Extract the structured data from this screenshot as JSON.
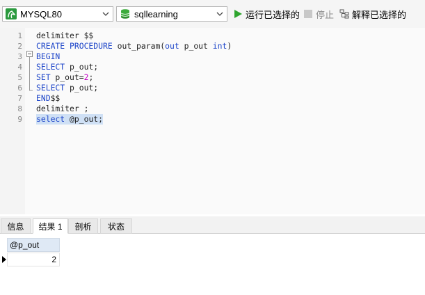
{
  "toolbar": {
    "connection": {
      "value": "MYSQL80",
      "icon": "mysql-dolphin-icon"
    },
    "database": {
      "value": "sqllearning",
      "icon": "database-icon"
    },
    "run_selected_label": "运行已选择的",
    "stop_label": "停止",
    "explain_selected_label": "解释已选择的"
  },
  "editor": {
    "lines": [
      {
        "num": "1",
        "tokens": [
          {
            "t": "delimiter $$",
            "c": ""
          }
        ]
      },
      {
        "num": "2",
        "tokens": [
          {
            "t": "CREATE PROCEDURE",
            "c": "kw"
          },
          {
            "t": " out_param(",
            "c": ""
          },
          {
            "t": "out",
            "c": "kw"
          },
          {
            "t": " p_out ",
            "c": ""
          },
          {
            "t": "int",
            "c": "kw"
          },
          {
            "t": ")",
            "c": ""
          }
        ]
      },
      {
        "num": "3",
        "tokens": [
          {
            "t": "BEGIN",
            "c": "kw"
          }
        ]
      },
      {
        "num": "4",
        "tokens": [
          {
            "t": "SELECT",
            "c": "kw"
          },
          {
            "t": " p_out;",
            "c": ""
          }
        ]
      },
      {
        "num": "5",
        "tokens": [
          {
            "t": "SET",
            "c": "kw"
          },
          {
            "t": " p_out=",
            "c": ""
          },
          {
            "t": "2",
            "c": "num"
          },
          {
            "t": ";",
            "c": ""
          }
        ]
      },
      {
        "num": "6",
        "tokens": [
          {
            "t": "SELECT",
            "c": "kw"
          },
          {
            "t": " p_out;",
            "c": ""
          }
        ]
      },
      {
        "num": "7",
        "tokens": [
          {
            "t": "END",
            "c": "kw"
          },
          {
            "t": "$$",
            "c": ""
          }
        ]
      },
      {
        "num": "8",
        "tokens": [
          {
            "t": "delimiter ;",
            "c": ""
          }
        ]
      },
      {
        "num": "9",
        "tokens": [
          {
            "t": "select",
            "c": "kw"
          },
          {
            "t": " @p_out;",
            "c": ""
          }
        ],
        "selected": true
      }
    ]
  },
  "result_tabs": [
    {
      "label": "信息",
      "active": false
    },
    {
      "label": "结果 1",
      "active": true
    },
    {
      "label": "剖析",
      "active": false
    },
    {
      "label": "状态",
      "active": false
    }
  ],
  "result_grid": {
    "columns": [
      "@p_out"
    ],
    "rows": [
      [
        "2"
      ]
    ]
  },
  "colors": {
    "keyword": "#1d45c9",
    "number": "#c400c4",
    "run_icon": "#2fa52f",
    "selection": "#cfe0f5"
  }
}
